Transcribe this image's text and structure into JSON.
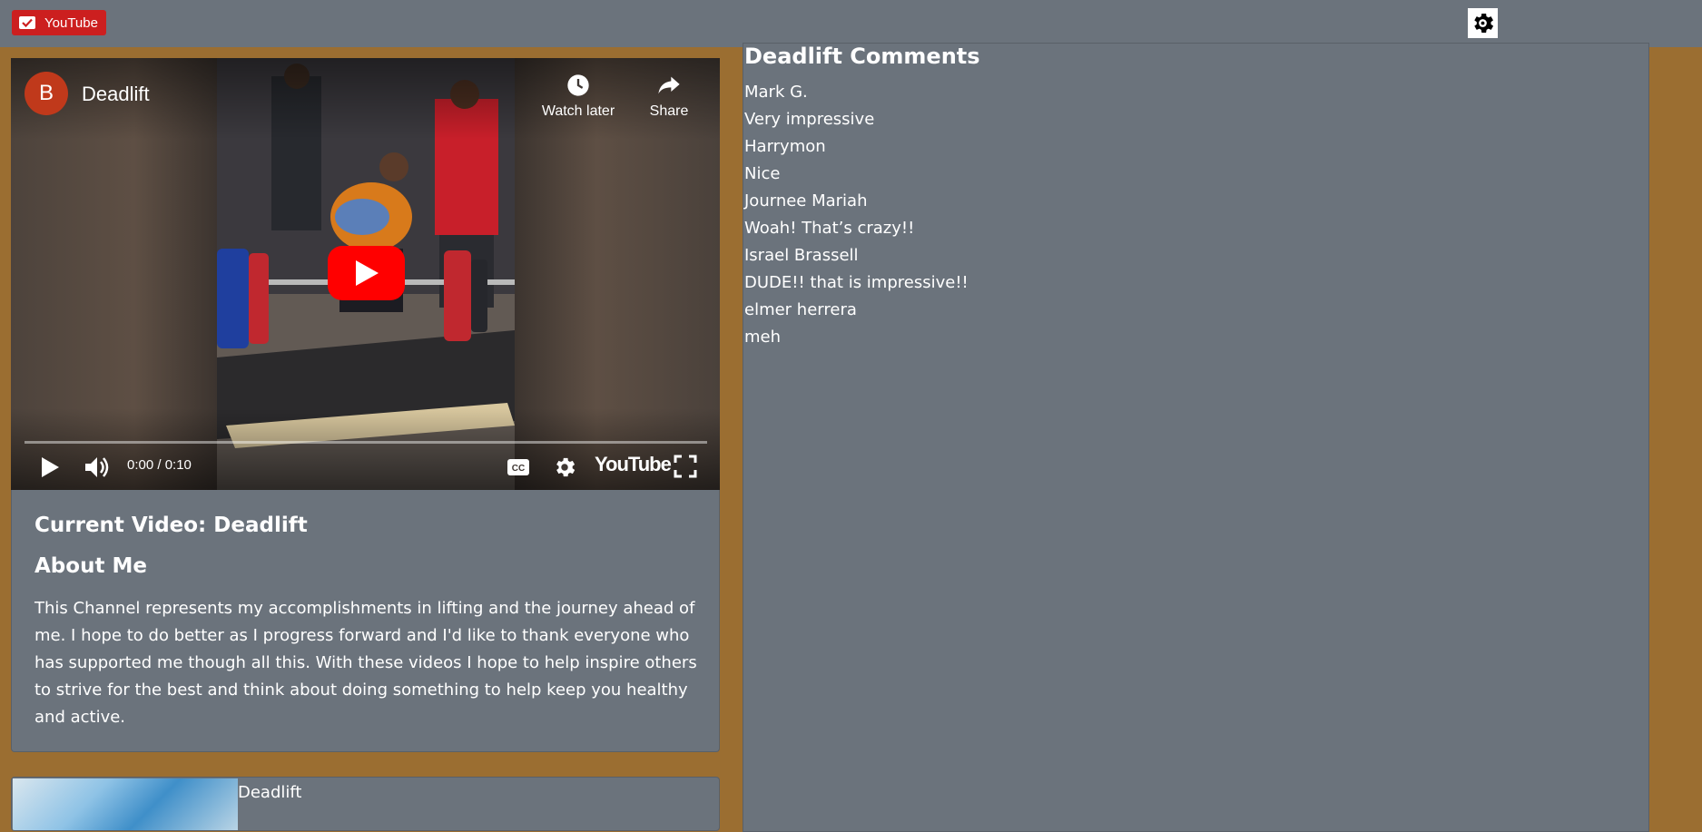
{
  "topbar": {
    "youtube_button_label": "YouTube",
    "gear_icon": "gear-icon"
  },
  "player": {
    "channel_initial": "B",
    "title": "Deadlift",
    "watch_later_label": "Watch later",
    "share_label": "Share",
    "time": "0:00 / 0:10",
    "wordmark": "YouTube",
    "progress": 0
  },
  "info": {
    "current_video": "Current Video: Deadlift",
    "about_heading": "About Me",
    "about_text": "This Channel represents my accomplishments in lifting and the journey ahead of me. I hope to do better as I progress forward and I'd like to thank everyone who has supported me though all this. With these videos I hope to help inspire others to strive for the best and think about doing something to help keep you healthy and active."
  },
  "video_list": [
    {
      "title": "Deadlift"
    }
  ],
  "comments": {
    "heading": "Deadlift Comments",
    "entries": [
      {
        "author": "Mark G.",
        "text": "Very impressive"
      },
      {
        "author": "Harrymon",
        "text": "Nice"
      },
      {
        "author": "Journee Mariah",
        "text": "Woah! That’s crazy!!"
      },
      {
        "author": "Israel Brassell",
        "text": "DUDE!! that is impressive!!"
      },
      {
        "author": "elmer herrera",
        "text": "meh"
      }
    ]
  },
  "colors": {
    "page_background": "#9b6e31",
    "panel": "#6b737c",
    "youtube_red": "#cc1f1f"
  }
}
